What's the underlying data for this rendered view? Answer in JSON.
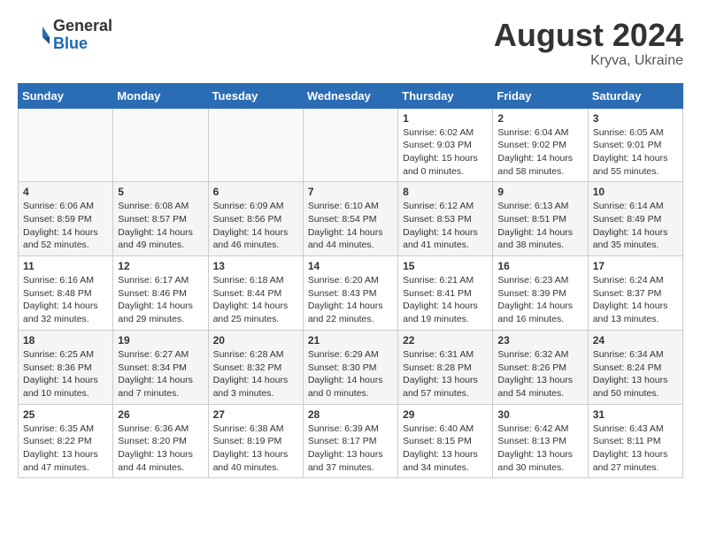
{
  "header": {
    "logo_general": "General",
    "logo_blue": "Blue",
    "month_year": "August 2024",
    "location": "Kryva, Ukraine"
  },
  "days_of_week": [
    "Sunday",
    "Monday",
    "Tuesday",
    "Wednesday",
    "Thursday",
    "Friday",
    "Saturday"
  ],
  "weeks": [
    [
      {
        "day": "",
        "info": ""
      },
      {
        "day": "",
        "info": ""
      },
      {
        "day": "",
        "info": ""
      },
      {
        "day": "",
        "info": ""
      },
      {
        "day": "1",
        "info": "Sunrise: 6:02 AM\nSunset: 9:03 PM\nDaylight: 15 hours and 0 minutes."
      },
      {
        "day": "2",
        "info": "Sunrise: 6:04 AM\nSunset: 9:02 PM\nDaylight: 14 hours and 58 minutes."
      },
      {
        "day": "3",
        "info": "Sunrise: 6:05 AM\nSunset: 9:01 PM\nDaylight: 14 hours and 55 minutes."
      }
    ],
    [
      {
        "day": "4",
        "info": "Sunrise: 6:06 AM\nSunset: 8:59 PM\nDaylight: 14 hours and 52 minutes."
      },
      {
        "day": "5",
        "info": "Sunrise: 6:08 AM\nSunset: 8:57 PM\nDaylight: 14 hours and 49 minutes."
      },
      {
        "day": "6",
        "info": "Sunrise: 6:09 AM\nSunset: 8:56 PM\nDaylight: 14 hours and 46 minutes."
      },
      {
        "day": "7",
        "info": "Sunrise: 6:10 AM\nSunset: 8:54 PM\nDaylight: 14 hours and 44 minutes."
      },
      {
        "day": "8",
        "info": "Sunrise: 6:12 AM\nSunset: 8:53 PM\nDaylight: 14 hours and 41 minutes."
      },
      {
        "day": "9",
        "info": "Sunrise: 6:13 AM\nSunset: 8:51 PM\nDaylight: 14 hours and 38 minutes."
      },
      {
        "day": "10",
        "info": "Sunrise: 6:14 AM\nSunset: 8:49 PM\nDaylight: 14 hours and 35 minutes."
      }
    ],
    [
      {
        "day": "11",
        "info": "Sunrise: 6:16 AM\nSunset: 8:48 PM\nDaylight: 14 hours and 32 minutes."
      },
      {
        "day": "12",
        "info": "Sunrise: 6:17 AM\nSunset: 8:46 PM\nDaylight: 14 hours and 29 minutes."
      },
      {
        "day": "13",
        "info": "Sunrise: 6:18 AM\nSunset: 8:44 PM\nDaylight: 14 hours and 25 minutes."
      },
      {
        "day": "14",
        "info": "Sunrise: 6:20 AM\nSunset: 8:43 PM\nDaylight: 14 hours and 22 minutes."
      },
      {
        "day": "15",
        "info": "Sunrise: 6:21 AM\nSunset: 8:41 PM\nDaylight: 14 hours and 19 minutes."
      },
      {
        "day": "16",
        "info": "Sunrise: 6:23 AM\nSunset: 8:39 PM\nDaylight: 14 hours and 16 minutes."
      },
      {
        "day": "17",
        "info": "Sunrise: 6:24 AM\nSunset: 8:37 PM\nDaylight: 14 hours and 13 minutes."
      }
    ],
    [
      {
        "day": "18",
        "info": "Sunrise: 6:25 AM\nSunset: 8:36 PM\nDaylight: 14 hours and 10 minutes."
      },
      {
        "day": "19",
        "info": "Sunrise: 6:27 AM\nSunset: 8:34 PM\nDaylight: 14 hours and 7 minutes."
      },
      {
        "day": "20",
        "info": "Sunrise: 6:28 AM\nSunset: 8:32 PM\nDaylight: 14 hours and 3 minutes."
      },
      {
        "day": "21",
        "info": "Sunrise: 6:29 AM\nSunset: 8:30 PM\nDaylight: 14 hours and 0 minutes."
      },
      {
        "day": "22",
        "info": "Sunrise: 6:31 AM\nSunset: 8:28 PM\nDaylight: 13 hours and 57 minutes."
      },
      {
        "day": "23",
        "info": "Sunrise: 6:32 AM\nSunset: 8:26 PM\nDaylight: 13 hours and 54 minutes."
      },
      {
        "day": "24",
        "info": "Sunrise: 6:34 AM\nSunset: 8:24 PM\nDaylight: 13 hours and 50 minutes."
      }
    ],
    [
      {
        "day": "25",
        "info": "Sunrise: 6:35 AM\nSunset: 8:22 PM\nDaylight: 13 hours and 47 minutes."
      },
      {
        "day": "26",
        "info": "Sunrise: 6:36 AM\nSunset: 8:20 PM\nDaylight: 13 hours and 44 minutes."
      },
      {
        "day": "27",
        "info": "Sunrise: 6:38 AM\nSunset: 8:19 PM\nDaylight: 13 hours and 40 minutes."
      },
      {
        "day": "28",
        "info": "Sunrise: 6:39 AM\nSunset: 8:17 PM\nDaylight: 13 hours and 37 minutes."
      },
      {
        "day": "29",
        "info": "Sunrise: 6:40 AM\nSunset: 8:15 PM\nDaylight: 13 hours and 34 minutes."
      },
      {
        "day": "30",
        "info": "Sunrise: 6:42 AM\nSunset: 8:13 PM\nDaylight: 13 hours and 30 minutes."
      },
      {
        "day": "31",
        "info": "Sunrise: 6:43 AM\nSunset: 8:11 PM\nDaylight: 13 hours and 27 minutes."
      }
    ]
  ]
}
